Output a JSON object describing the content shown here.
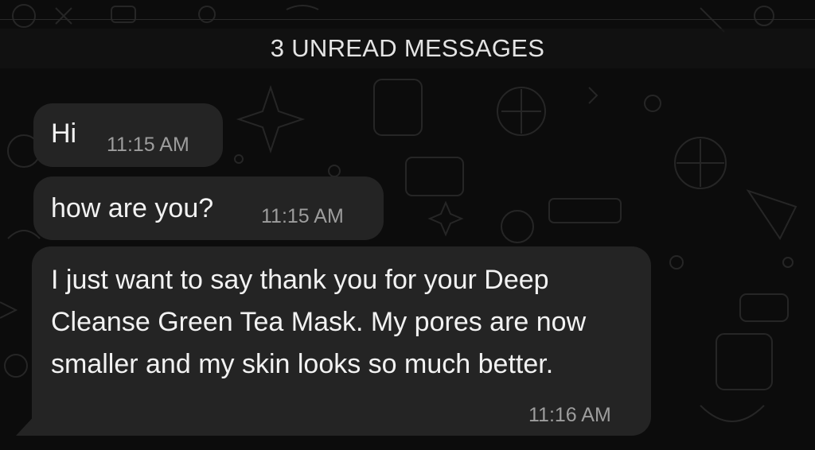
{
  "banner": {
    "unread_label": "3 UNREAD MESSAGES"
  },
  "messages": [
    {
      "text": "Hi",
      "time": "11:15 AM"
    },
    {
      "text": "how are you?",
      "time": "11:15 AM"
    },
    {
      "text": "I just want to say thank you for your Deep Cleanse Green Tea Mask. My pores are now smaller and my skin looks so much better.",
      "time": "11:16 AM"
    }
  ],
  "colors": {
    "background": "#0c0c0c",
    "bubble": "#242424",
    "text": "#f2f2f2",
    "timestamp": "#9d9d9d"
  }
}
